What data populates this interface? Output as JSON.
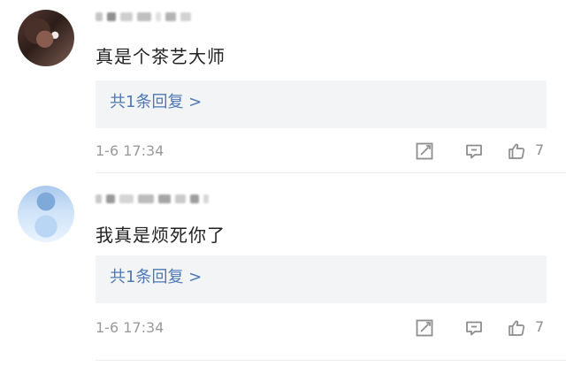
{
  "comments": [
    {
      "text": "真是个茶艺大师",
      "reply_label": "共1条回复 >",
      "timestamp": "1-6 17:34",
      "likes": "7"
    },
    {
      "text": "我真是烦死你了",
      "reply_label": "共1条回复 >",
      "timestamp": "1-6 17:34",
      "likes": "7"
    }
  ],
  "icons": {
    "edit": "edit-icon",
    "comment": "comment-icon",
    "like": "thumbs-up-icon"
  },
  "colors": {
    "reply_link": "#4d78b4",
    "meta_text": "#9a9a9a",
    "reply_bg": "#f3f4f6"
  }
}
